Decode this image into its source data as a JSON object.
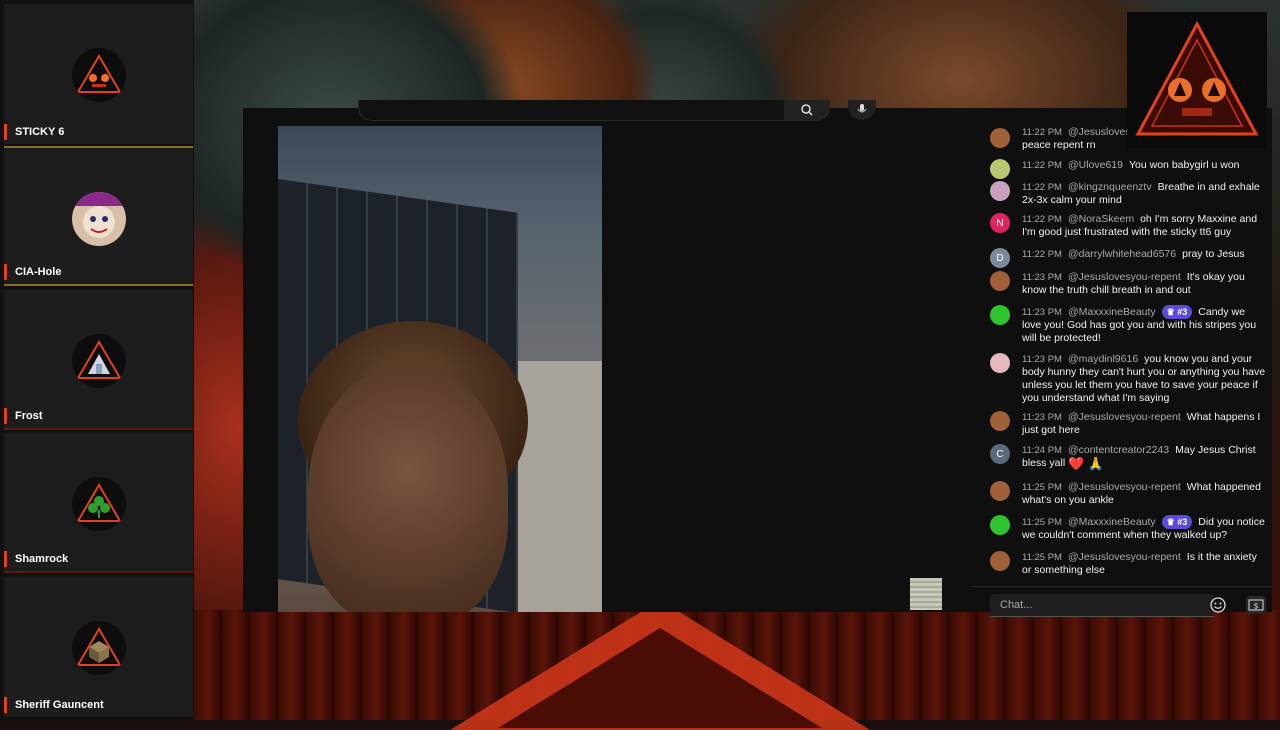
{
  "sidebar": {
    "participants": [
      {
        "name": "STICKY 6",
        "avatar_icon": "sticky-triangle-icon"
      },
      {
        "name": "CIA-Hole",
        "avatar_icon": "clown-face-icon"
      },
      {
        "name": "Frost",
        "avatar_icon": "frost-triangle-icon"
      },
      {
        "name": "Shamrock",
        "avatar_icon": "shamrock-triangle-icon"
      },
      {
        "name": "Sheriff Gauncent",
        "avatar_icon": "cube-triangle-icon"
      }
    ]
  },
  "chat": {
    "input_placeholder": "Chat...",
    "messages": [
      {
        "time": "11:22 PM",
        "author": "@Jesuslovesyou-repent",
        "text": "peace repent rn",
        "avatar_color": "#a0603a"
      },
      {
        "time": "11:22 PM",
        "author": "@Ulove619",
        "text": "You won babygirl u won",
        "avatar_color": "#b8c870"
      },
      {
        "time": "11:22 PM",
        "author": "@kingznqueenztv",
        "text": "Breathe in and exhale 2x-3x calm your mind",
        "avatar_color": "#c8a0c0"
      },
      {
        "time": "11:22 PM",
        "author": "@NoraSkeem",
        "text": "oh I'm sorry Maxxine and I'm good just frustrated with the sticky tt6 guy",
        "avatar_letter": "N",
        "avatar_color": "#e0245e"
      },
      {
        "time": "11:22 PM",
        "author": "@darrylwhitehead6576",
        "text": "pray to Jesus",
        "avatar_letter": "D",
        "avatar_color": "#7a8a9a"
      },
      {
        "time": "11:23 PM",
        "author": "@Jesuslovesyou-repent",
        "text": "It's okay you know the truth chill breath in and out",
        "avatar_color": "#a0603a"
      },
      {
        "time": "11:23 PM",
        "author": "@MaxxxineBeauty",
        "badge": "#3",
        "text": "Candy we love you! God has got you and with his stripes you will be protected!",
        "avatar_color": "#2ec42e"
      },
      {
        "time": "11:23 PM",
        "author": "@maydinl9616",
        "text": "you know you and your body hunny they can't hurt you or anything you have unless you let them you have to save your peace if you understand what I'm saying",
        "avatar_color": "#e8b8c0"
      },
      {
        "time": "11:23 PM",
        "author": "@Jesuslovesyou-repent",
        "text": "What happens I just got here",
        "avatar_color": "#a0603a"
      },
      {
        "time": "11:24 PM",
        "author": "@contentcreator2243",
        "text": "May Jesus Christ bless yall",
        "emojis": "❤️ 🙏",
        "avatar_letter": "C",
        "avatar_color": "#5a6a7a"
      },
      {
        "time": "11:25 PM",
        "author": "@Jesuslovesyou-repent",
        "text": "What happened what's on you ankle",
        "avatar_color": "#a0603a"
      },
      {
        "time": "11:25 PM",
        "author": "@MaxxxineBeauty",
        "badge": "#3",
        "text": "Did you notice we couldn't comment when they walked up?",
        "avatar_color": "#2ec42e"
      },
      {
        "time": "11:25 PM",
        "author": "@Jesuslovesyou-repent",
        "text": "Is it the anxiety or something else",
        "avatar_color": "#a0603a"
      }
    ]
  },
  "colors": {
    "accent_red": "#e0421e",
    "badge_purple": "#5c4ad8"
  }
}
